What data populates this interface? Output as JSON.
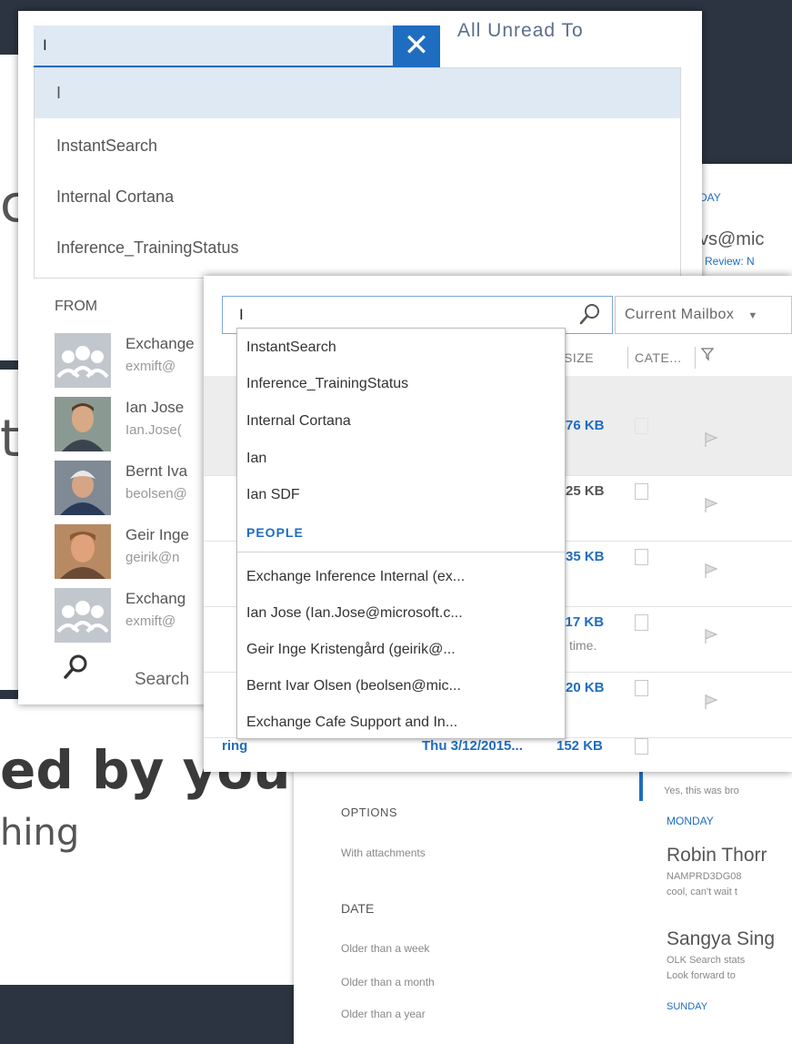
{
  "background": {
    "heading_partial": "ed by you",
    "subtext_partial": "hing",
    "edge_letters": [
      "c",
      "t"
    ]
  },
  "panel1": {
    "search_value": "I",
    "clear_icon": "close-icon",
    "filter_tabs": "All   Unread   To",
    "suggestions": [
      "I",
      "InstantSearch",
      "Internal Cortana",
      "Inference_TrainingStatus"
    ],
    "from_header": "FROM",
    "people": [
      {
        "name": "Exchange",
        "email": "exmift@",
        "avatar": "group-avatar"
      },
      {
        "name": "Ian Jose",
        "email": "Ian.Jose(",
        "avatar": "photo"
      },
      {
        "name": "Bernt Iva",
        "email": "beolsen@",
        "avatar": "photo"
      },
      {
        "name": "Geir Inge",
        "email": "geirik@n",
        "avatar": "photo"
      },
      {
        "name": "Exchang",
        "email": "exmift@",
        "avatar": "group-avatar"
      }
    ],
    "search_label": "Search"
  },
  "panel2": {
    "search_value": "I",
    "scope_label": "Current Mailbox",
    "columns": {
      "size": "SIZE",
      "categories": "CATE...",
      "flag_icon": "filter-flag-icon"
    },
    "rows": [
      {
        "size": "76 KB",
        "bold": true
      },
      {
        "size": "25 KB",
        "bold": false
      },
      {
        "size": "35 KB",
        "bold": true
      },
      {
        "size": "117 KB",
        "bold": true,
        "snippet": "time."
      },
      {
        "size": "20 KB",
        "bold": true
      }
    ],
    "last_row": {
      "subject": "ring",
      "date": "Thu 3/12/2015...",
      "size": "152 KB"
    },
    "dropdown": {
      "suggestions": [
        "InstantSearch",
        "Inference_TrainingStatus",
        "Internal Cortana",
        "Ian",
        "Ian SDF"
      ],
      "people_header": "PEOPLE",
      "people": [
        "Exchange Inference Internal (ex...",
        "Ian Jose (Ian.Jose@microsoft.c...",
        "Geir Inge Kristengård (geirik@...",
        "Bernt Ivar Olsen (beolsen@mic...",
        "Exchange Cafe Support and In..."
      ]
    }
  },
  "backpanel": {
    "right_top_day": "DAY",
    "right_top_email": "vs@mic",
    "right_top_link": "Review: N",
    "options_header": "OPTIONS",
    "with_attachments": "With attachments",
    "date_header": "DATE",
    "date_options": [
      "Older than a week",
      "Older than a month",
      "Older than a year"
    ],
    "list_snippet_top": "Yes, this was bro",
    "day_monday": "MONDAY",
    "sender1": "Robin Thorr",
    "sender1_line2": "NAMPRD3DG08",
    "sender1_line3": "cool, can't wait t",
    "sender2": "Sangya Sing",
    "sender2_line2": "OLK Search stats",
    "sender2_line3": "Look forward to",
    "day_sunday": "SUNDAY"
  }
}
